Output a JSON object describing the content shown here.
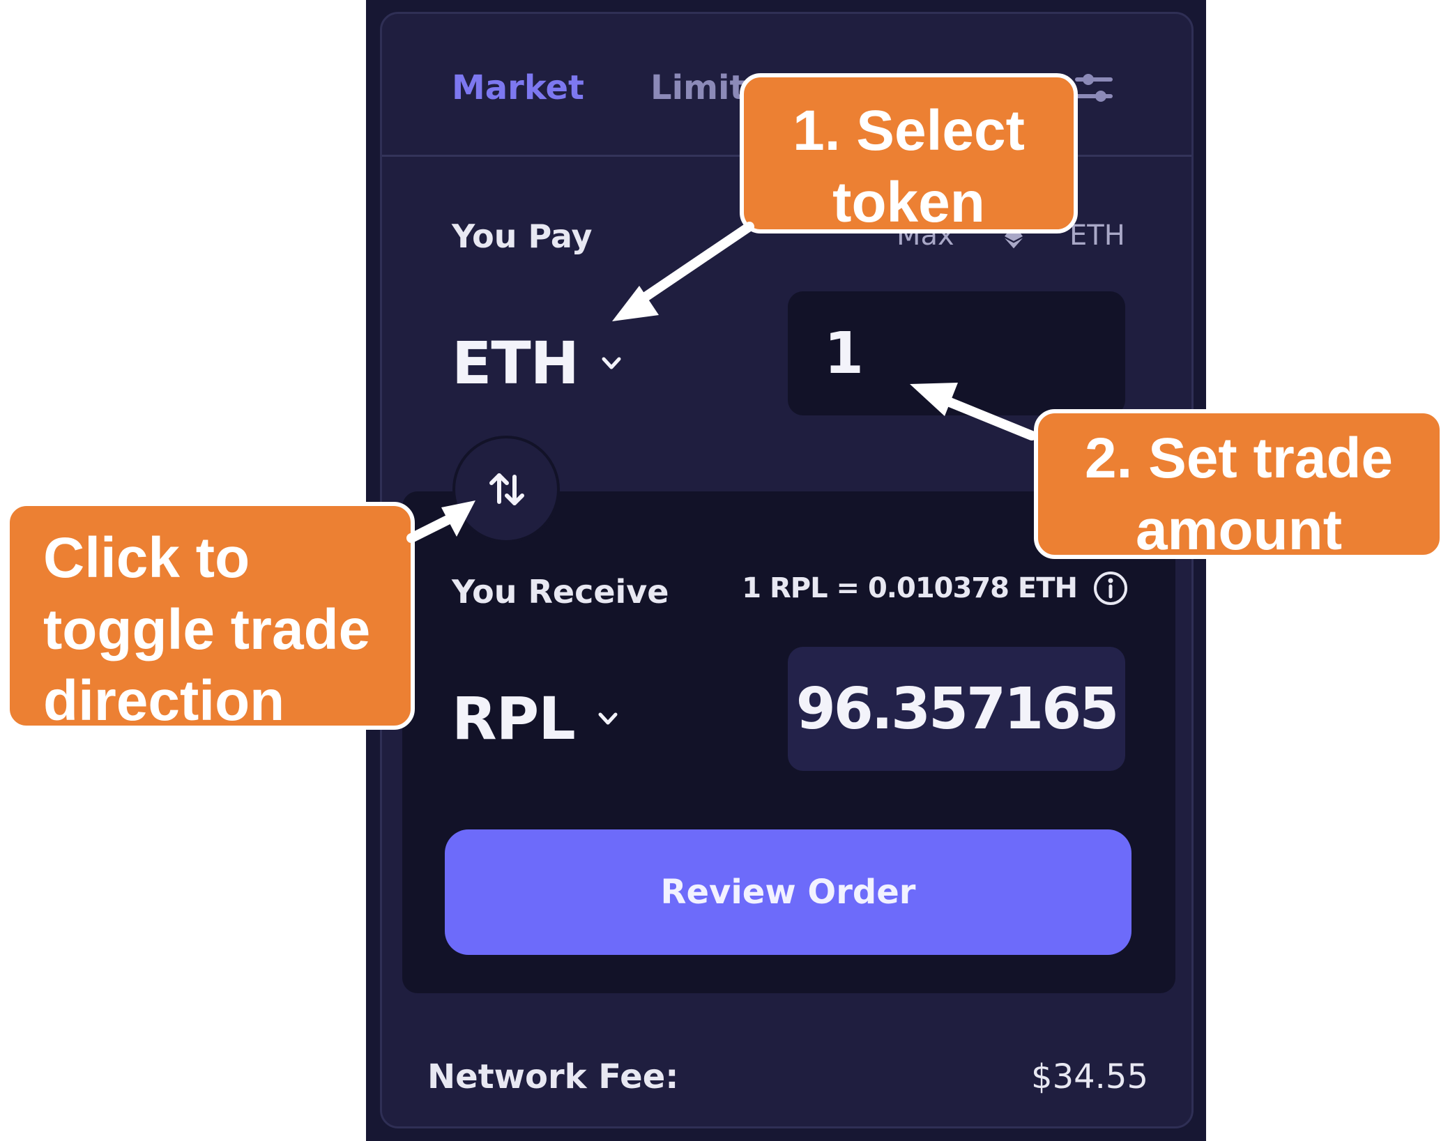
{
  "tabs": {
    "market": "Market",
    "limit": "Limit"
  },
  "pay": {
    "label": "You Pay",
    "max_label": "Max",
    "balance_unit": "ETH",
    "token": "ETH",
    "amount": "1"
  },
  "receive": {
    "label": "You Receive",
    "rate": "1 RPL = 0.010378 ETH",
    "token": "RPL",
    "amount": "96.357165"
  },
  "review_button": "Review Order",
  "network_fee": {
    "label": "Network Fee:",
    "value": "$34.55"
  },
  "callouts": {
    "select_token": [
      "1. Select",
      "token"
    ],
    "set_amount": [
      "2. Set trade",
      "amount"
    ],
    "toggle_direction": [
      "Click to",
      "toggle trade",
      "direction"
    ]
  },
  "icons": [
    "settings-sliders-icon",
    "chevron-down-icon",
    "swap-arrows-icon",
    "info-icon",
    "eth-diamond-icon"
  ],
  "colors": {
    "accent": "#6d6bfa",
    "panel_bg": "#1f1e3f",
    "field_bg": "#121228",
    "callout": "#ec8033"
  }
}
